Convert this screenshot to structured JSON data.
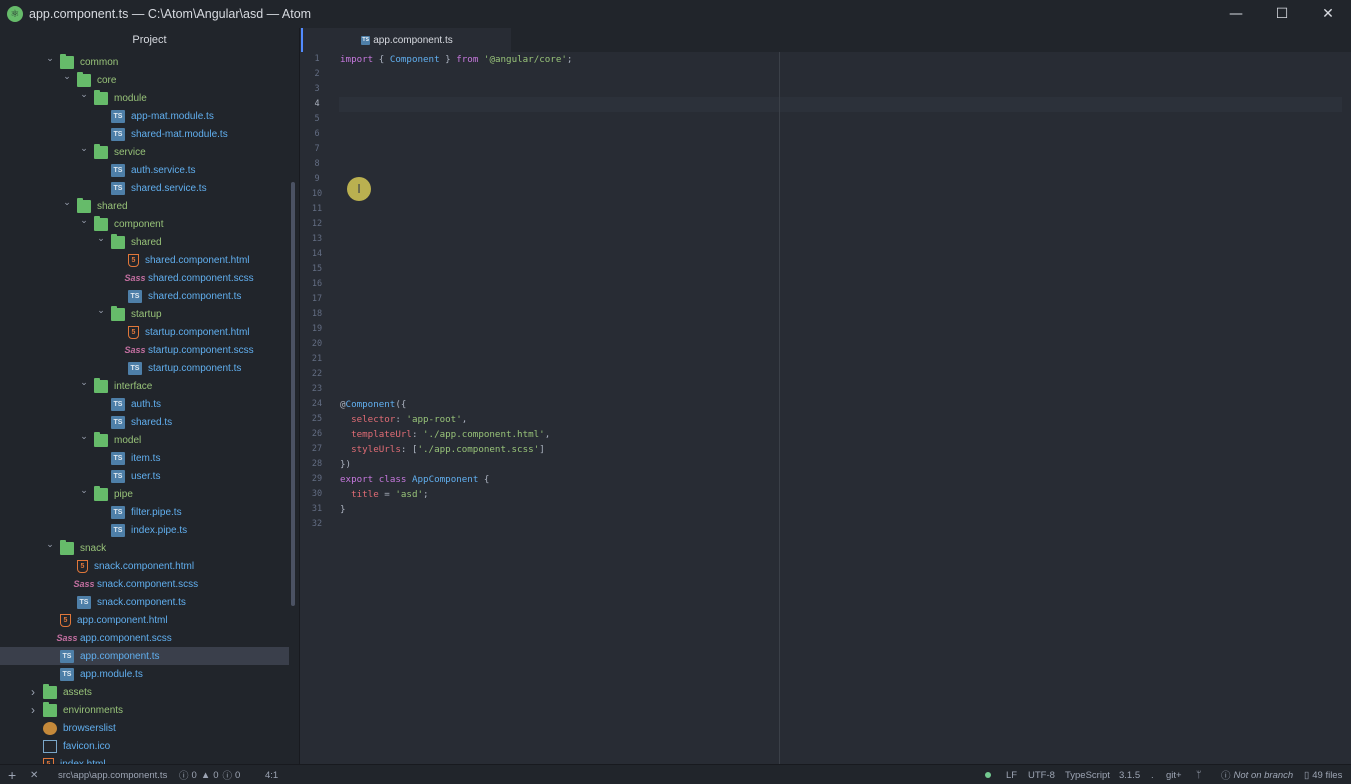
{
  "window": {
    "title": "app.component.ts — C:\\Atom\\Angular\\asd — Atom",
    "min_glyph": "—",
    "max_glyph": "☐",
    "close_glyph": "✕"
  },
  "tree": {
    "header": "Project",
    "items": [
      {
        "label": "common",
        "type": "folder",
        "depth": 3,
        "open": true
      },
      {
        "label": "core",
        "type": "folder",
        "depth": 4,
        "open": true
      },
      {
        "label": "module",
        "type": "folder",
        "depth": 5,
        "open": true
      },
      {
        "label": "app-mat.module.ts",
        "type": "ts",
        "depth": 6
      },
      {
        "label": "shared-mat.module.ts",
        "type": "ts",
        "depth": 6
      },
      {
        "label": "service",
        "type": "folder",
        "depth": 5,
        "open": true
      },
      {
        "label": "auth.service.ts",
        "type": "ts",
        "depth": 6
      },
      {
        "label": "shared.service.ts",
        "type": "ts",
        "depth": 6
      },
      {
        "label": "shared",
        "type": "folder",
        "depth": 4,
        "open": true
      },
      {
        "label": "component",
        "type": "folder",
        "depth": 5,
        "open": true
      },
      {
        "label": "shared",
        "type": "folder",
        "depth": 6,
        "open": true
      },
      {
        "label": "shared.component.html",
        "type": "html",
        "depth": 7
      },
      {
        "label": "shared.component.scss",
        "type": "scss",
        "depth": 7
      },
      {
        "label": "shared.component.ts",
        "type": "ts",
        "depth": 7
      },
      {
        "label": "startup",
        "type": "folder",
        "depth": 6,
        "open": true
      },
      {
        "label": "startup.component.html",
        "type": "html",
        "depth": 7
      },
      {
        "label": "startup.component.scss",
        "type": "scss",
        "depth": 7
      },
      {
        "label": "startup.component.ts",
        "type": "ts",
        "depth": 7
      },
      {
        "label": "interface",
        "type": "folder",
        "depth": 5,
        "open": true
      },
      {
        "label": "auth.ts",
        "type": "ts",
        "depth": 6
      },
      {
        "label": "shared.ts",
        "type": "ts",
        "depth": 6
      },
      {
        "label": "model",
        "type": "folder",
        "depth": 5,
        "open": true
      },
      {
        "label": "item.ts",
        "type": "ts",
        "depth": 6
      },
      {
        "label": "user.ts",
        "type": "ts",
        "depth": 6
      },
      {
        "label": "pipe",
        "type": "folder",
        "depth": 5,
        "open": true
      },
      {
        "label": "filter.pipe.ts",
        "type": "ts",
        "depth": 6
      },
      {
        "label": "index.pipe.ts",
        "type": "ts",
        "depth": 6
      },
      {
        "label": "snack",
        "type": "folder",
        "depth": 3,
        "open": true
      },
      {
        "label": "snack.component.html",
        "type": "html",
        "depth": 4
      },
      {
        "label": "snack.component.scss",
        "type": "scss",
        "depth": 4
      },
      {
        "label": "snack.component.ts",
        "type": "ts",
        "depth": 4
      },
      {
        "label": "app.component.html",
        "type": "html",
        "depth": 3
      },
      {
        "label": "app.component.scss",
        "type": "scss",
        "depth": 3
      },
      {
        "label": "app.component.ts",
        "type": "ts",
        "depth": 3,
        "selected": true
      },
      {
        "label": "app.module.ts",
        "type": "ts",
        "depth": 3
      },
      {
        "label": "assets",
        "type": "folder",
        "depth": 2,
        "open": false
      },
      {
        "label": "environments",
        "type": "folder",
        "depth": 2,
        "open": false
      },
      {
        "label": "browserslist",
        "type": "gear",
        "depth": 2
      },
      {
        "label": "favicon.ico",
        "type": "image",
        "depth": 2
      },
      {
        "label": "index.html",
        "type": "html",
        "depth": 2
      }
    ],
    "icon_text": {
      "ts": "TS",
      "html": "5",
      "scss": "Sass"
    }
  },
  "tabs": [
    {
      "label": "app.component.ts",
      "active": true
    }
  ],
  "editor": {
    "active_line": 4,
    "line_count": 32,
    "lines": {
      "1": [
        [
          "kw",
          "import"
        ],
        [
          "pun",
          " { "
        ],
        [
          "cls",
          "Component"
        ],
        [
          "pun",
          " } "
        ],
        [
          "kw",
          "from"
        ],
        [
          "pun",
          " "
        ],
        [
          "str",
          "'@angular/core'"
        ],
        [
          "pun",
          ";"
        ]
      ],
      "24": [
        [
          "pun",
          "@"
        ],
        [
          "dec",
          "Component"
        ],
        [
          "pun",
          "({"
        ]
      ],
      "25": [
        [
          "pun",
          "  "
        ],
        [
          "prop",
          "selector"
        ],
        [
          "pun",
          ": "
        ],
        [
          "str",
          "'app-root'"
        ],
        [
          "pun",
          ","
        ]
      ],
      "26": [
        [
          "pun",
          "  "
        ],
        [
          "prop",
          "templateUrl"
        ],
        [
          "pun",
          ": "
        ],
        [
          "str",
          "'./app.component.html'"
        ],
        [
          "pun",
          ","
        ]
      ],
      "27": [
        [
          "pun",
          "  "
        ],
        [
          "prop",
          "styleUrls"
        ],
        [
          "pun",
          ": ["
        ],
        [
          "str",
          "'./app.component.scss'"
        ],
        [
          "pun",
          "]"
        ]
      ],
      "28": [
        [
          "pun",
          "})"
        ]
      ],
      "29": [
        [
          "kw",
          "export"
        ],
        [
          "pun",
          " "
        ],
        [
          "kw",
          "class"
        ],
        [
          "pun",
          " "
        ],
        [
          "cls",
          "AppComponent"
        ],
        [
          "pun",
          " {"
        ]
      ],
      "30": [
        [
          "pun",
          "  "
        ],
        [
          "prop",
          "title"
        ],
        [
          "pun",
          " = "
        ],
        [
          "str",
          "'asd'"
        ],
        [
          "pun",
          ";"
        ]
      ],
      "31": [
        [
          "pun",
          "}"
        ]
      ]
    }
  },
  "status_bar": {
    "add_glyph": "+",
    "close_glyph": "✕",
    "file_path": "src\\app\\app.component.ts",
    "errors": "0",
    "warnings": "0",
    "infos": "0",
    "cursor_position": "4:1",
    "line_ending": "LF",
    "encoding": "UTF-8",
    "grammar": "TypeScript",
    "ts_version": "3.1.5",
    "dot": ".",
    "git_label": "git+",
    "branch": "Not on branch",
    "file_count": "49 files"
  },
  "colors": {
    "folder": "#66bb6a",
    "ts_icon": "#4e7fa8",
    "html_icon": "#e0773a",
    "scss_icon": "#c36fa0",
    "accent": "#528bff"
  }
}
